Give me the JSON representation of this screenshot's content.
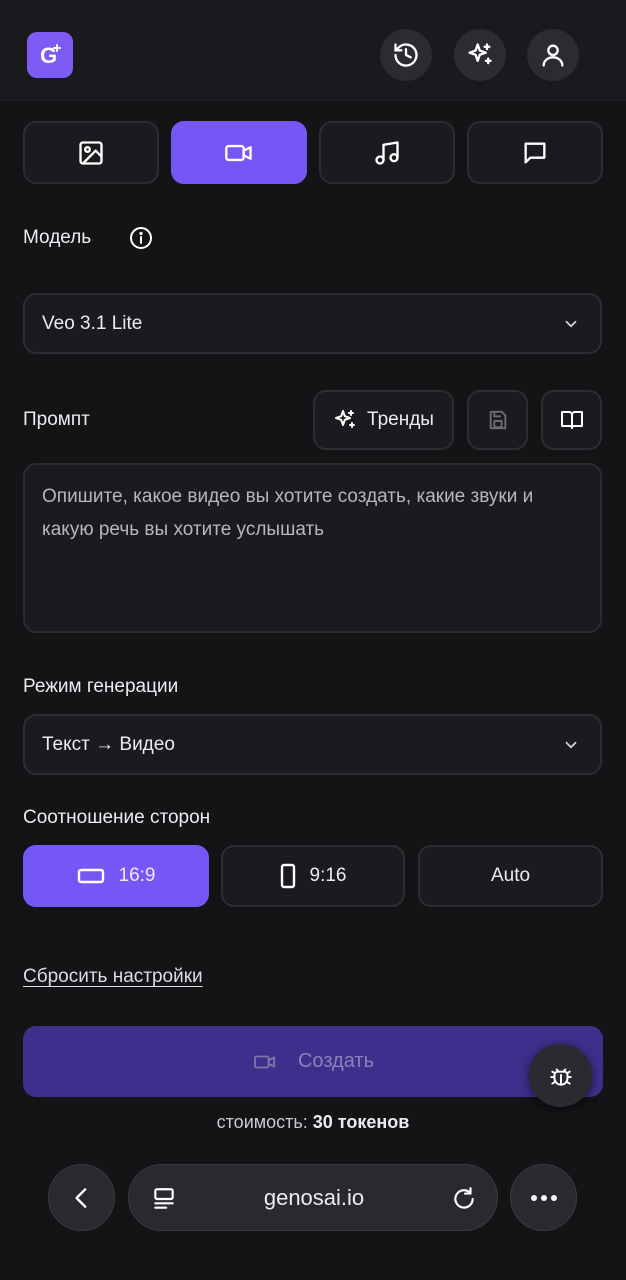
{
  "header": {
    "logo_letter": "G",
    "buttons": [
      "history-icon",
      "sparkles-icon",
      "user-icon"
    ]
  },
  "media_tabs": [
    {
      "icon": "image-icon",
      "active": false
    },
    {
      "icon": "video-icon",
      "active": true
    },
    {
      "icon": "music-icon",
      "active": false
    },
    {
      "icon": "chat-icon",
      "active": false
    }
  ],
  "model": {
    "label": "Модель",
    "value": "Veo 3.1 Lite"
  },
  "prompt": {
    "label": "Промпт",
    "trends_label": "Тренды",
    "placeholder": "Опишите, какое видео вы хотите создать, какие звуки и какую речь вы хотите услышать"
  },
  "generation_mode": {
    "label": "Режим генерации",
    "value": "Текст → Видео"
  },
  "aspect_ratio": {
    "label": "Соотношение сторон",
    "options": [
      {
        "label": "16:9",
        "active": true
      },
      {
        "label": "9:16",
        "active": false
      },
      {
        "label": "Auto",
        "active": false
      }
    ]
  },
  "reset_label": "Сбросить настройки",
  "create_label": "Создать",
  "cost": {
    "prefix": "стоимость:",
    "amount": "30 токенов"
  },
  "browser": {
    "url": "genosai.io"
  },
  "colors": {
    "accent": "#7557f6",
    "create_disabled": "#3f2f8c",
    "background": "#141417"
  }
}
